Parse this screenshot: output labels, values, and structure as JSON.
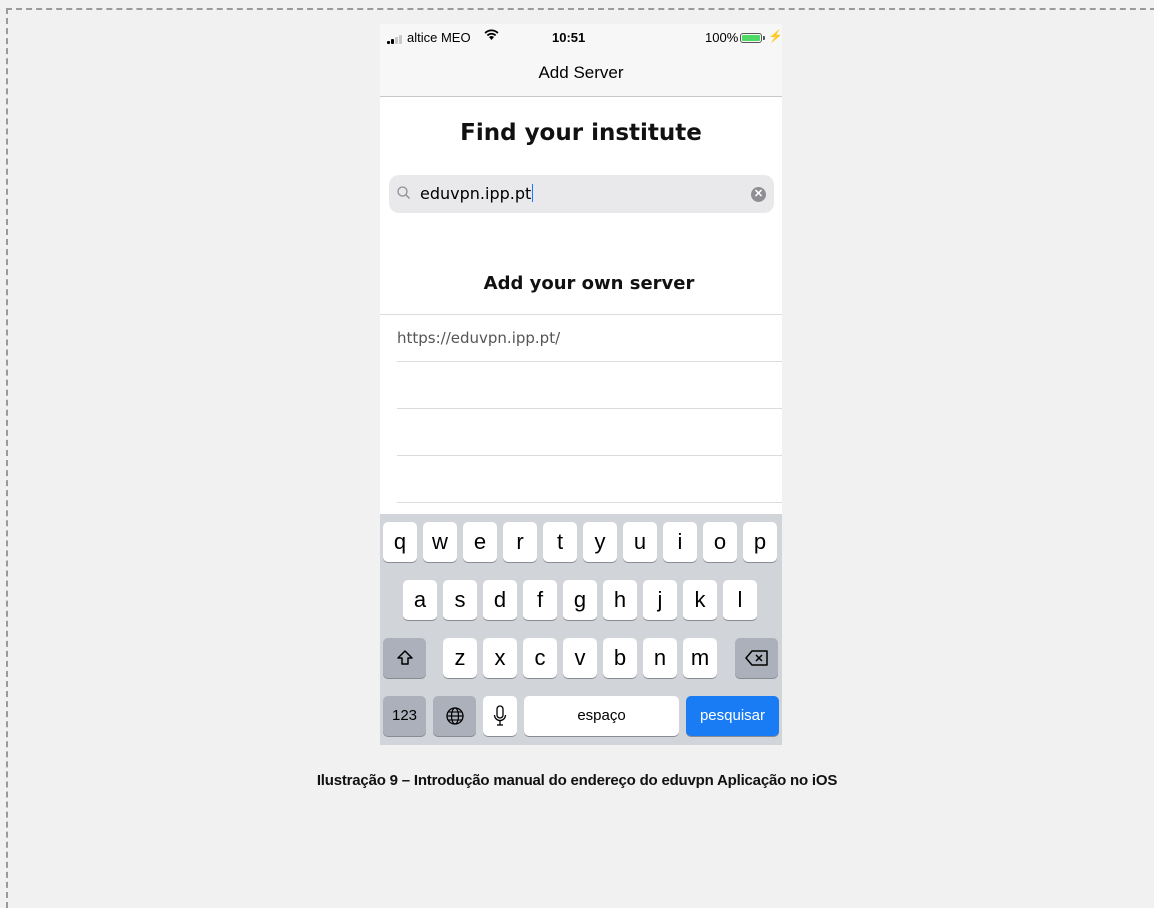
{
  "status_bar": {
    "carrier": "altice MEO",
    "time": "10:51",
    "battery": "100%"
  },
  "nav": {
    "title": "Add Server"
  },
  "find": {
    "title": "Find your institute"
  },
  "search": {
    "value": "eduvpn.ipp.pt"
  },
  "own_server": {
    "title": "Add your own server",
    "url": "https://eduvpn.ipp.pt/"
  },
  "keyboard": {
    "row1": [
      "q",
      "w",
      "e",
      "r",
      "t",
      "y",
      "u",
      "i",
      "o",
      "p"
    ],
    "row2": [
      "a",
      "s",
      "d",
      "f",
      "g",
      "h",
      "j",
      "k",
      "l"
    ],
    "row3": [
      "z",
      "x",
      "c",
      "v",
      "b",
      "n",
      "m"
    ],
    "numbers_label": "123",
    "space_label": "espaço",
    "search_label": "pesquisar",
    "icons": [
      "shift-icon",
      "backspace-icon",
      "globe-icon",
      "microphone-icon"
    ]
  },
  "caption": "Ilustração 9 – Introdução manual do endereço do eduvpn Aplicação no iOS",
  "colors": {
    "accent": "#1a7cf5",
    "keyboard_bg": "#d1d4d9",
    "page_bg": "#f1f1f1"
  }
}
